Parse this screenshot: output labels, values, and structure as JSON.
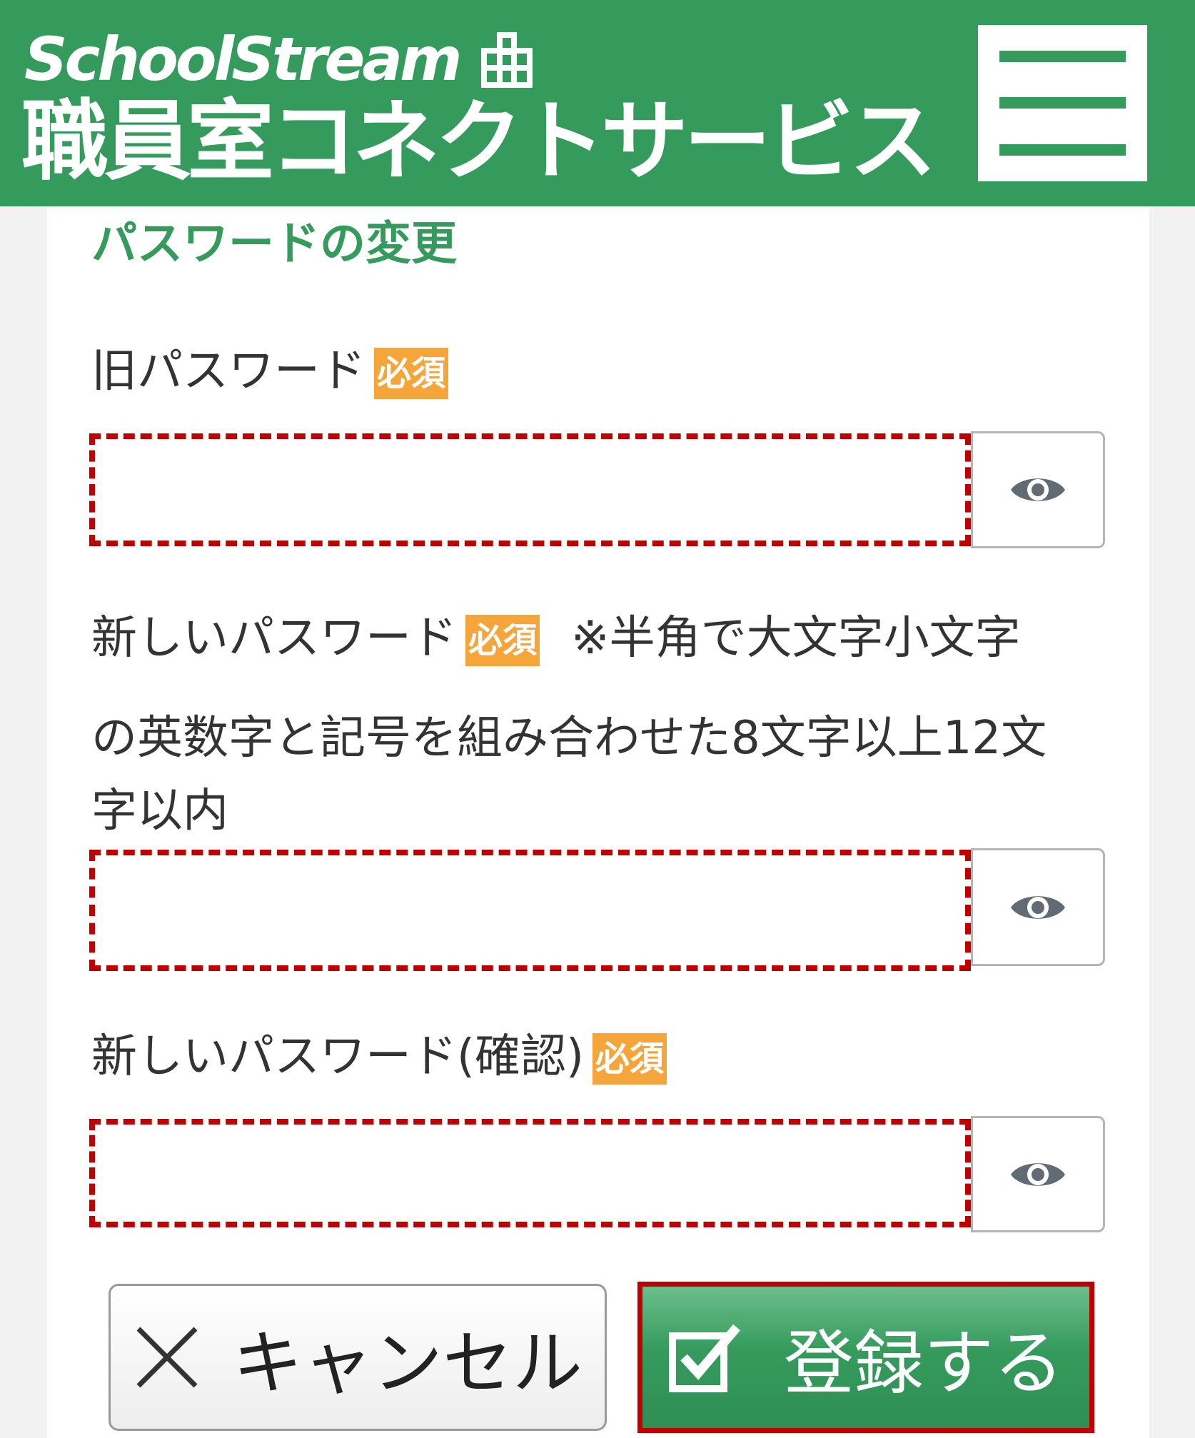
{
  "header": {
    "brand": "SchoolStream",
    "service_name": "職員室コネクトサービス",
    "icons": [
      "building-icon",
      "hamburger-menu-icon"
    ],
    "colors": {
      "primary": "#359b5d"
    }
  },
  "form": {
    "title": "パスワードの変更",
    "required_badge": "必須",
    "old_password": {
      "label": "旧パスワード",
      "value": ""
    },
    "new_password": {
      "label": "新しいパスワード",
      "note_line1": "※半角で大文字小文字",
      "note_line2": "の英数字と記号を組み合わせた8文字以上12文",
      "note_line3": "字以内",
      "value": ""
    },
    "confirm_password": {
      "label": "新しいパスワード(確認)",
      "value": ""
    },
    "toggle_icon": "eye-icon",
    "highlight_color": "#c00000",
    "required_color": "#f6a53a"
  },
  "buttons": {
    "cancel_label": "キャンセル",
    "submit_label": "登録する"
  }
}
